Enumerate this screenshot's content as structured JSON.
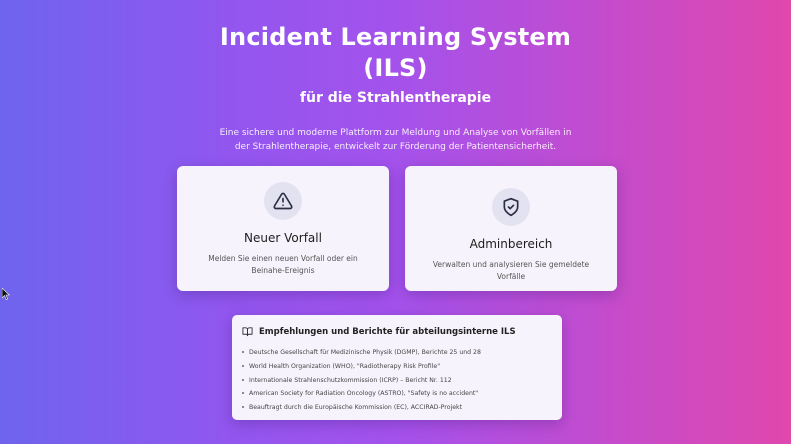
{
  "header": {
    "title": "Incident Learning System (ILS)",
    "subtitle": "für die Strahlentherapie",
    "description": "Eine sichere und moderne Plattform zur Meldung und Analyse von Vorfällen in der Strahlentherapie, entwickelt zur Förderung der Patientensicherheit."
  },
  "cards": {
    "new_incident": {
      "icon": "warning-triangle-icon",
      "title": "Neuer Vorfall",
      "text": "Melden Sie einen neuen Vorfall oder ein Beinahe-Ereignis"
    },
    "admin": {
      "icon": "shield-check-icon",
      "title": "Adminbereich",
      "text": "Verwalten und analysieren Sie gemeldete Vorfälle"
    }
  },
  "references": {
    "icon": "book-open-icon",
    "heading": "Empfehlungen und Berichte für abteilungsinterne ILS",
    "items": [
      "Deutsche Gesellschaft für Medizinische Physik (DGMP), Berichte 25 und 28",
      "World Health Organization (WHO), \"Radiotherapy Risk Profile\"",
      "Internationale Strahlenschutzkommission (ICRP) – Bericht Nr. 112",
      "American Society for Radiation Oncology (ASTRO), \"Safety is no accident\"",
      "Beauftragt durch die Europäische Kommission (EC), ACCIRAD-Projekt"
    ]
  },
  "colors": {
    "gradient_start": "#6f64ee",
    "gradient_end": "#e048ac",
    "card_bg": "#f7f3fc",
    "icon_circle_bg": "#e3e2f0"
  }
}
